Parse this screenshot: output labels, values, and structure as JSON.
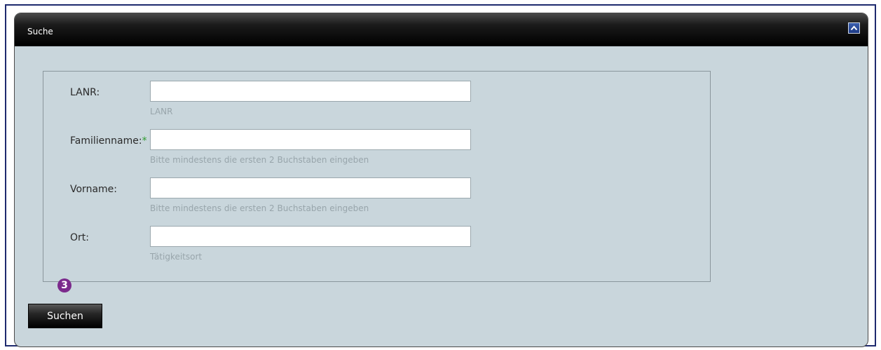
{
  "panel": {
    "title": "Suche",
    "collapse_icon": "chevron-up-icon"
  },
  "form": {
    "fields": [
      {
        "label": "LANR:",
        "required": false,
        "value": "",
        "hint": "LANR"
      },
      {
        "label": "Familienname:",
        "required": true,
        "required_marker": "*",
        "value": "",
        "hint": "Bitte mindestens die ersten 2 Buchstaben eingeben"
      },
      {
        "label": "Vorname:",
        "required": false,
        "value": "",
        "hint": "Bitte mindestens die ersten 2 Buchstaben eingeben"
      },
      {
        "label": "Ort:",
        "required": false,
        "value": "",
        "hint": "Tätigkeitsort"
      }
    ]
  },
  "step_badge": "3",
  "search_button": {
    "label": "Suchen"
  },
  "colors": {
    "panel_background": "#c9d6dc",
    "header_background": "#000000",
    "required_marker": "#2e9b2e",
    "hint_text": "#98a5ab",
    "step_badge": "#7b2a8c",
    "frame_border": "#1e2a6e"
  }
}
